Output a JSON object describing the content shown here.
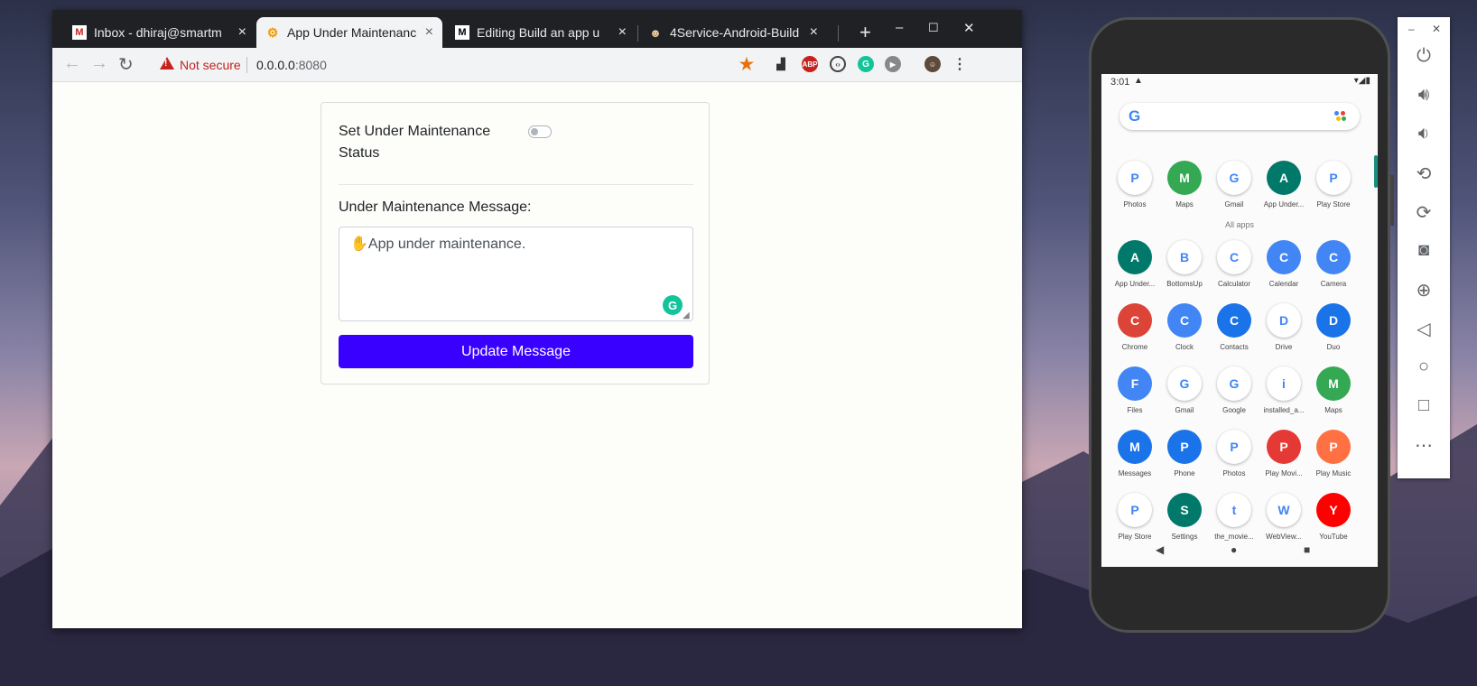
{
  "browser": {
    "tabs": [
      {
        "title": "Inbox - dhiraj@smartm",
        "favicon": "gmail-icon",
        "active": false
      },
      {
        "title": "App Under Maintenanc",
        "favicon": "flutter-gear-icon",
        "active": true
      },
      {
        "title": "Editing Build an app u",
        "favicon": "medium-icon",
        "active": false
      },
      {
        "title": "4Service-Android-Build",
        "favicon": "jenkins-icon",
        "active": false
      }
    ],
    "new_tab": "+",
    "window_controls": {
      "minimize": "–",
      "maximize": "☐",
      "close": "✕"
    },
    "nav": {
      "back": "←",
      "forward": "→",
      "reload": "↻"
    },
    "security_text": "Not secure",
    "url_host": "0.0.0.0",
    "url_port": ":8080",
    "extensions": [
      "bookmark-star-icon",
      "extension-icon",
      "adblock-plus-icon",
      "code-icon",
      "grammarly-icon",
      "media-icon",
      "profile-avatar-icon",
      "menu-icon"
    ]
  },
  "page": {
    "status_label": "Set Under Maintenance Status",
    "status_on": false,
    "message_label": "Under Maintenance Message:",
    "message_value": "✋App under maintenance.",
    "update_button": "Update Message"
  },
  "phone": {
    "status_time": "3:01",
    "search_g": "G",
    "all_apps_label": "All apps",
    "favorites": [
      {
        "label": "Photos",
        "color": "#ffffff"
      },
      {
        "label": "Maps",
        "color": "#34a853"
      },
      {
        "label": "Gmail",
        "color": "#ffffff"
      },
      {
        "label": "App Under...",
        "color": "#00796b"
      },
      {
        "label": "Play Store",
        "color": "#ffffff"
      }
    ],
    "apps": [
      {
        "label": "App Under...",
        "color": "#00796b"
      },
      {
        "label": "BottomsUp",
        "color": "#ffffff"
      },
      {
        "label": "Calculator",
        "color": "#ffffff"
      },
      {
        "label": "Calendar",
        "color": "#4285f4"
      },
      {
        "label": "Camera",
        "color": "#4285f4"
      },
      {
        "label": "Chrome",
        "color": "#db4437"
      },
      {
        "label": "Clock",
        "color": "#4285f4"
      },
      {
        "label": "Contacts",
        "color": "#1a73e8"
      },
      {
        "label": "Drive",
        "color": "#ffffff"
      },
      {
        "label": "Duo",
        "color": "#1a73e8"
      },
      {
        "label": "Files",
        "color": "#4285f4"
      },
      {
        "label": "Gmail",
        "color": "#ffffff"
      },
      {
        "label": "Google",
        "color": "#ffffff"
      },
      {
        "label": "installed_a...",
        "color": "#ffffff"
      },
      {
        "label": "Maps",
        "color": "#34a853"
      },
      {
        "label": "Messages",
        "color": "#1a73e8"
      },
      {
        "label": "Phone",
        "color": "#1a73e8"
      },
      {
        "label": "Photos",
        "color": "#ffffff"
      },
      {
        "label": "Play Movi...",
        "color": "#e53935"
      },
      {
        "label": "Play Music",
        "color": "#ff7043"
      },
      {
        "label": "Play Store",
        "color": "#ffffff"
      },
      {
        "label": "Settings",
        "color": "#00796b"
      },
      {
        "label": "the_movie...",
        "color": "#ffffff"
      },
      {
        "label": "WebView...",
        "color": "#ffffff"
      },
      {
        "label": "YouTube",
        "color": "#ff0000"
      }
    ]
  },
  "emulator_panel": {
    "top_controls": {
      "minimize": "–",
      "close": "✕"
    },
    "buttons": [
      "power-icon",
      "volume-up-icon",
      "volume-down-icon",
      "rotate-left-icon",
      "rotate-right-icon",
      "screenshot-icon",
      "zoom-icon",
      "back-icon",
      "home-icon",
      "overview-icon",
      "more-icon"
    ]
  },
  "colors": {
    "accent": "#3a00ff",
    "insecure": "#c5221f",
    "grammarly": "#15c39a"
  }
}
